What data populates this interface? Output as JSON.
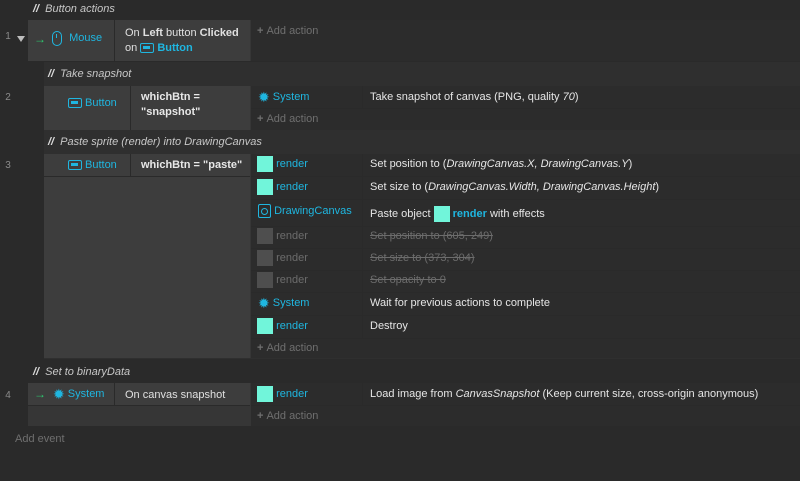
{
  "groups": {
    "button_actions": "Button actions",
    "take_snapshot": "Take snapshot",
    "paste_sprite": "Paste sprite (render) into DrawingCanvas",
    "set_binary": "Set to binaryData"
  },
  "comment_slashes": "//",
  "row_numbers": [
    "1",
    "2",
    "3",
    "4"
  ],
  "trigger_arrow": "→",
  "add_action": "Add action",
  "add_event": "Add event",
  "event1": {
    "object": "Mouse",
    "cond_on": "On",
    "cond_left": "Left",
    "cond_button": "button",
    "cond_clicked": "Clicked",
    "cond_on2": "on",
    "cond_obj": "Button"
  },
  "event2": {
    "object": "Button",
    "cond_line1": "whichBtn =",
    "cond_line2": "\"snapshot\"",
    "action_obj": "System",
    "action_text": "Take snapshot of canvas (PNG, quality ",
    "action_quality": "70",
    "action_close": ")"
  },
  "event3": {
    "object": "Button",
    "cond": "whichBtn = \"paste\"",
    "actions": [
      {
        "obj": "render",
        "pre": "Set position to (",
        "ital": "DrawingCanvas.X, DrawingCanvas.Y",
        "post": ")"
      },
      {
        "obj": "render",
        "pre": "Set size to (",
        "ital": "DrawingCanvas.Width, DrawingCanvas.Height",
        "post": ")"
      },
      {
        "obj": "DrawingCanvas",
        "pre": "Paste object ",
        "obj2": "render",
        "post": " with effects"
      },
      {
        "obj": "render",
        "text": "Set position to (605, 249)"
      },
      {
        "obj": "render",
        "text": "Set size to (373, 304)"
      },
      {
        "obj": "render",
        "text": "Set opacity to 0"
      },
      {
        "obj": "System",
        "text": "Wait for previous actions to complete"
      },
      {
        "obj": "render",
        "text": "Destroy"
      }
    ]
  },
  "event4": {
    "object": "System",
    "cond": "On canvas snapshot",
    "action_obj": "render",
    "action_pre": "Load image from ",
    "action_ital": "CanvasSnapshot",
    "action_post": " (Keep current size, cross-origin anonymous)"
  },
  "colors": {
    "accent": "#1fb6e0",
    "trigger": "#2ecc71",
    "sprite": "#71f5da",
    "background": "#2a2a2a"
  }
}
